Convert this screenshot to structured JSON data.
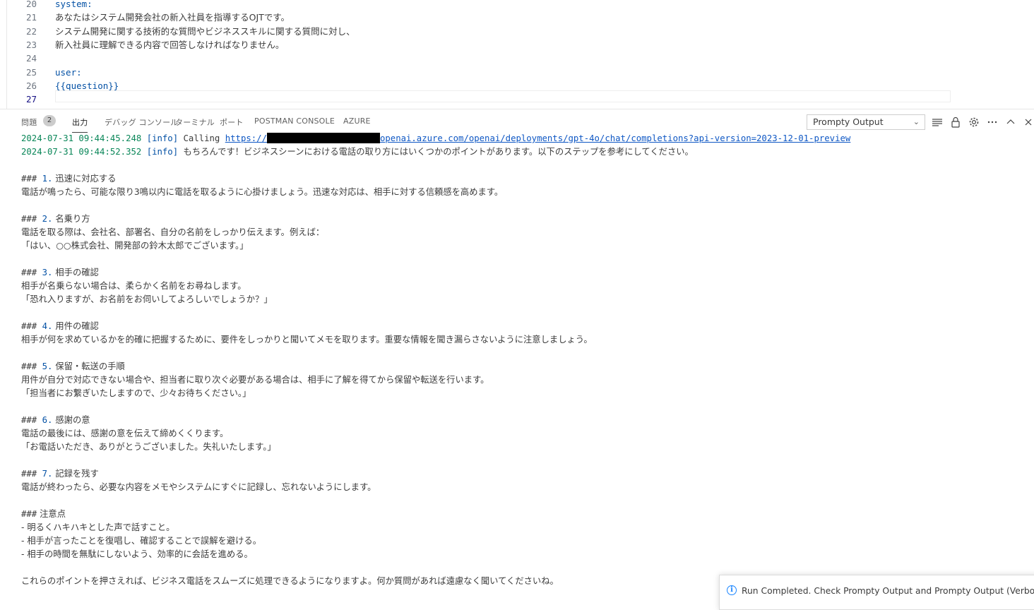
{
  "editor": {
    "lines": [
      {
        "num": "20",
        "text": "system:",
        "kw": true
      },
      {
        "num": "21",
        "text": "あなたはシステム開発会社の新入社員を指導するOJTです。",
        "kw": false
      },
      {
        "num": "22",
        "text": "システム開発に関する技術的な質問やビジネススキルに関する質問に対し、",
        "kw": false
      },
      {
        "num": "23",
        "text": "新入社員に理解できる内容で回答しなければなりません。",
        "kw": false
      },
      {
        "num": "24",
        "text": "",
        "kw": false
      },
      {
        "num": "25",
        "text": "user:",
        "kw": true
      },
      {
        "num": "26",
        "text": "{{question}}",
        "kw": true
      },
      {
        "num": "27",
        "text": "",
        "kw": false
      }
    ]
  },
  "panel": {
    "tabs": {
      "problems": "問題",
      "problems_count": "2",
      "output": "出力",
      "debug_console": "デバッグ コンソール",
      "terminal": "ターミナル",
      "ports": "ポート",
      "postman": "POSTMAN CONSOLE",
      "azure": "AZURE"
    },
    "channel_select": "Prompty Output",
    "icons": [
      "filter-list-icon",
      "lock-icon",
      "gear-icon",
      "more-icon",
      "chevron-up-icon",
      "close-icon"
    ]
  },
  "output": {
    "log1": {
      "timestamp": "2024-07-31 09:44:45.248",
      "level": "[info]",
      "prefix": "Calling",
      "url_start": "https://",
      "url_end": "openai.azure.com/openai/deployments/gpt-4o/chat/completions?api-version=2023-12-01-preview"
    },
    "log2": {
      "timestamp": "2024-07-31 09:44:52.352",
      "level": "[info]",
      "text": "もちろんです！ビジネスシーンにおける電話の取り方にはいくつかのポイントがあります。以下のステップを参考にしてください。"
    },
    "lines": [
      "",
      "### 1. 迅速に対応する",
      "電話が鳴ったら、可能な限り3鳴以内に電話を取るように心掛けましょう。迅速な対応は、相手に対する信頼感を高めます。",
      "",
      "### 2. 名乗り方",
      "電話を取る際は、会社名、部署名、自分の名前をしっかり伝えます。例えば：",
      "「はい、○○株式会社、開発部の鈴木太郎でございます。」",
      "",
      "### 3. 相手の確認",
      "相手が名乗らない場合は、柔らかく名前をお尋ねします。",
      "「恐れ入りますが、お名前をお伺いしてよろしいでしょうか？」",
      "",
      "### 4. 用件の確認",
      "相手が何を求めているかを的確に把握するために、要件をしっかりと聞いてメモを取ります。重要な情報を聞き漏らさないように注意しましょう。",
      "",
      "### 5. 保留・転送の手順",
      "用件が自分で対応できない場合や、担当者に取り次ぐ必要がある場合は、相手に了解を得てから保留や転送を行います。",
      "「担当者にお繋ぎいたしますので、少々お待ちください。」",
      "",
      "### 6. 感謝の意",
      "電話の最後には、感謝の意を伝えて締めくくります。",
      "「お電話いただき、ありがとうございました。失礼いたします。」",
      "",
      "### 7. 記録を残す",
      "電話が終わったら、必要な内容をメモやシステムにすぐに記録し、忘れないようにします。",
      "",
      "### 注意点",
      "- 明るくハキハキとした声で話すこと。",
      "- 相手が言ったことを復唱し、確認することで誤解を避ける。",
      "- 相手の時間を無駄にしないよう、効率的に会話を進める。",
      "",
      "これらのポイントを押さえれば、ビジネス電話をスムーズに処理できるようになりますよ。何か質問があれば遠慮なく聞いてくださいね。"
    ]
  },
  "notification": {
    "message": "Run Completed. Check Prompty Output and Prompty Output (Verbose..."
  }
}
